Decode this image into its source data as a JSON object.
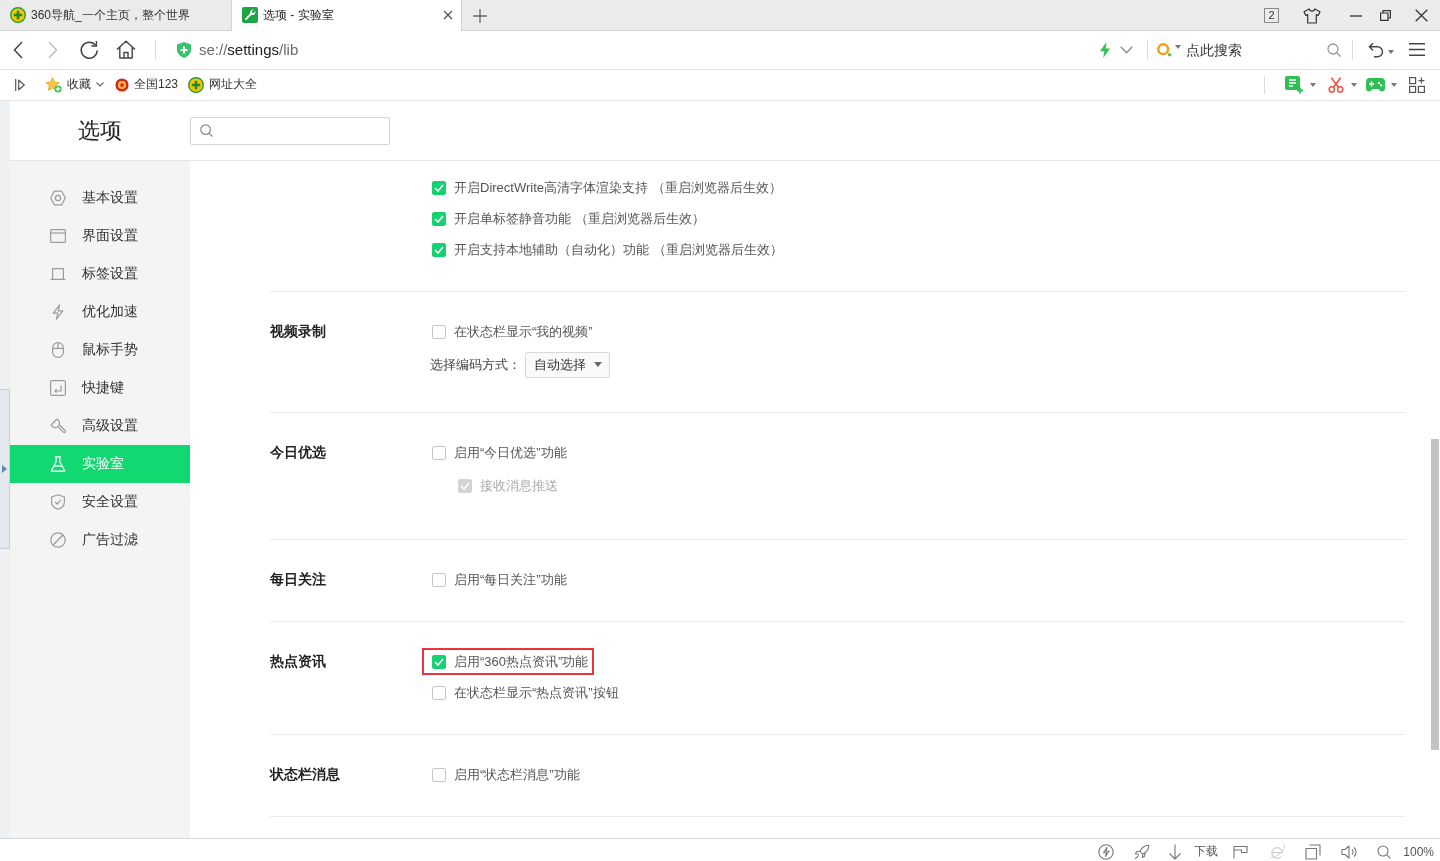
{
  "tabs": [
    {
      "title": "360导航_一个主页，整个世界",
      "selected": false
    },
    {
      "title": "选项 - 实验室",
      "selected": true
    }
  ],
  "window": {
    "tab_count": "2"
  },
  "toolbar": {
    "url": "se://**settings**/lib",
    "search": {
      "placeholder": "点此搜索"
    }
  },
  "bookmarks": [
    {
      "label": "收藏",
      "kind": "folder"
    },
    {
      "label": "全国123",
      "kind": "link"
    },
    {
      "label": "网址大全",
      "kind": "link"
    }
  ],
  "settings": {
    "title": "选项",
    "sidebar": {
      "items": [
        {
          "label": "基本设置",
          "selected": false
        },
        {
          "label": "界面设置",
          "selected": false
        },
        {
          "label": "标签设置",
          "selected": false
        },
        {
          "label": "优化加速",
          "selected": false
        },
        {
          "label": "鼠标手势",
          "selected": false
        },
        {
          "label": "快捷键",
          "selected": false
        },
        {
          "label": "高级设置",
          "selected": false
        },
        {
          "label": "实验室",
          "selected": true
        },
        {
          "label": "安全设置",
          "selected": false
        },
        {
          "label": "广告过滤",
          "selected": false
        }
      ]
    },
    "sections": [
      {
        "options": [
          {
            "kind": "checkbox",
            "label": "开启DirectWrite高清字体渲染支持 （重启浏览器后生效）",
            "checked": true,
            "disabled": false,
            "highlighted": false
          },
          {
            "kind": "checkbox",
            "label": "开启单标签静音功能 （重启浏览器后生效）",
            "checked": true,
            "disabled": false,
            "highlighted": false
          },
          {
            "kind": "checkbox",
            "label": "开启支持本地辅助（自动化）功能 （重启浏览器后生效）",
            "checked": true,
            "disabled": false,
            "highlighted": false
          }
        ]
      },
      {
        "label": "视频录制",
        "options": [
          {
            "kind": "checkbox",
            "label": "在状态栏显示“我的视频”",
            "checked": false,
            "disabled": false,
            "highlighted": false
          },
          {
            "kind": "select",
            "label": "选择编码方式：",
            "value": "自动选择"
          }
        ]
      },
      {
        "label": "今日优选",
        "options": [
          {
            "kind": "checkbox",
            "label": "启用“今日优选”功能",
            "checked": false,
            "disabled": false,
            "highlighted": false,
            "children": [
              {
                "kind": "checkbox",
                "label": "接收消息推送",
                "checked": true,
                "disabled": true,
                "highlighted": false
              }
            ]
          }
        ]
      },
      {
        "label": "每日关注",
        "options": [
          {
            "kind": "checkbox",
            "label": "启用“每日关注”功能",
            "checked": false,
            "disabled": false,
            "highlighted": false
          }
        ]
      },
      {
        "label": "热点资讯",
        "options": [
          {
            "kind": "checkbox",
            "label": "启用“360热点资讯”功能",
            "checked": true,
            "disabled": false,
            "highlighted": true
          },
          {
            "kind": "checkbox",
            "label": "在状态栏显示“热点资讯”按钮",
            "checked": false,
            "disabled": false,
            "highlighted": false
          }
        ]
      },
      {
        "label": "状态栏消息",
        "options": [
          {
            "kind": "checkbox",
            "label": "启用“状态栏消息”功能",
            "checked": false,
            "disabled": false,
            "highlighted": false
          }
        ]
      }
    ]
  },
  "status_bar": {
    "download": "下载",
    "zoom": "100%"
  }
}
